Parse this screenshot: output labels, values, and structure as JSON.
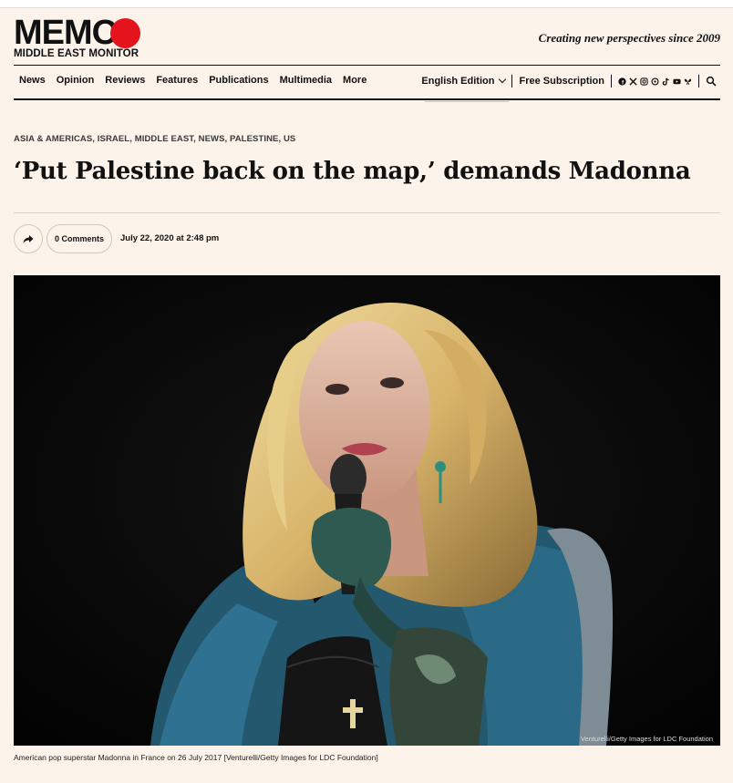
{
  "logo": {
    "wordmark": "MEMO",
    "subtitle": "MIDDLE EAST MONITOR"
  },
  "tagline": "Creating new perspectives since 2009",
  "nav": {
    "items": [
      "News",
      "Opinion",
      "Reviews",
      "Features",
      "Publications",
      "Multimedia",
      "More"
    ],
    "edition": "English Edition",
    "subscription": "Free Subscription",
    "social_icons": [
      "facebook-icon",
      "x-icon",
      "instagram-icon",
      "threads-icon",
      "tiktok-icon",
      "youtube-icon",
      "bluesky-icon"
    ],
    "search_icon": "search-icon"
  },
  "article": {
    "categories": "ASIA & AMERICAS, ISRAEL, MIDDLE EAST, NEWS, PALESTINE, US",
    "title": "‘Put Palestine back on the map,’ demands Madonna",
    "comments": "0 Comments",
    "date": "July 22, 2020 at 2:48 pm",
    "photo_credit": "Venturelli/Getty Images for LDC Foundation",
    "caption": "American pop superstar Madonna in France on 26 July 2017 [Venturelli/Getty Images for LDC Foundation]"
  },
  "colors": {
    "background": "#fcf3ea",
    "brand_red": "#e3141b",
    "text": "#111111"
  }
}
